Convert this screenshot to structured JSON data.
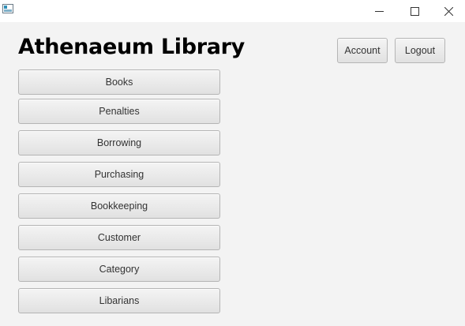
{
  "window": {
    "controls": {
      "minimize_icon": "minimize-icon",
      "maximize_icon": "maximize-icon",
      "close_icon": "close-icon"
    },
    "app_icon": "app-window-icon"
  },
  "header": {
    "title": "Athenaeum Library",
    "account_label": "Account",
    "logout_label": "Logout"
  },
  "menu": {
    "items": [
      {
        "label": "Books"
      },
      {
        "label": "Penalties"
      },
      {
        "label": "Borrowing"
      },
      {
        "label": "Purchasing"
      },
      {
        "label": "Bookkeeping"
      },
      {
        "label": "Customer"
      },
      {
        "label": "Category"
      },
      {
        "label": "Libarians"
      }
    ]
  },
  "colors": {
    "background": "#f3f3f3",
    "titlebar": "#ffffff",
    "button_border": "#b5b5b5",
    "button_text": "#333333"
  }
}
